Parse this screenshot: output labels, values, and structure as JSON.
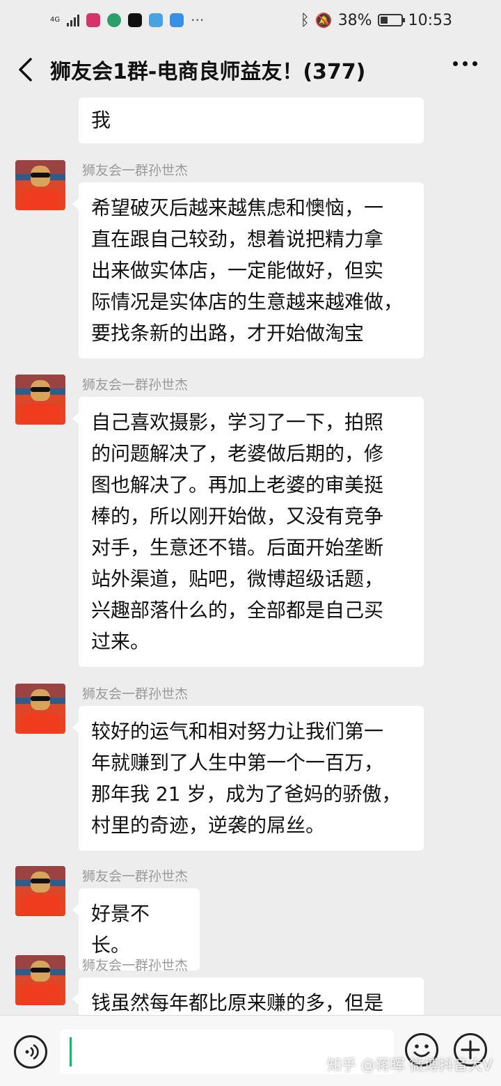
{
  "status_bar": {
    "network": "4G",
    "battery": "38%",
    "time": "10:53",
    "battery_level": 0.38
  },
  "header": {
    "back_icon": "chevron-left-icon",
    "title": "狮友会1群-电商良师益友！(377)",
    "more_icon": "more-dots-icon"
  },
  "messages": [
    {
      "sender": "",
      "text": "我"
    },
    {
      "sender": "狮友会一群孙世杰",
      "text": "希望破灭后越来越焦虑和懊恼，一\n直在跟自己较劲，想着说把精力拿\n出来做实体店，一定能做好，但实\n际情况是实体店的生意越来越难做，\n要找条新的出路，才开始做淘宝"
    },
    {
      "sender": "狮友会一群孙世杰",
      "text": "自己喜欢摄影，学习了一下，拍照\n的问题解决了，老婆做后期的，修\n图也解决了。再加上老婆的审美挺\n棒的，所以刚开始做，又没有竞争\n对手，生意还不错。后面开始垄断\n站外渠道，贴吧，微博超级话题，\n兴趣部落什么的，全部都是自己买\n过来。"
    },
    {
      "sender": "狮友会一群孙世杰",
      "text": "较好的运气和相对努力让我们第一\n年就赚到了人生中第一个一百万，\n那年我 21 岁，成为了爸妈的骄傲，\n村里的奇迹，逆袭的屌丝。"
    },
    {
      "sender": "狮友会一群孙世杰",
      "text": "好景不长。"
    },
    {
      "sender": "狮友会一群孙世杰",
      "text": "钱虽然每年都比原来赚的多，但是"
    }
  ],
  "input_bar": {
    "voice_icon": "voice-icon",
    "emoji_icon": "emoji-icon",
    "plus_icon": "plus-icon",
    "value": ""
  },
  "watermark": "知乎 @蒋晖 微博抖音大V"
}
